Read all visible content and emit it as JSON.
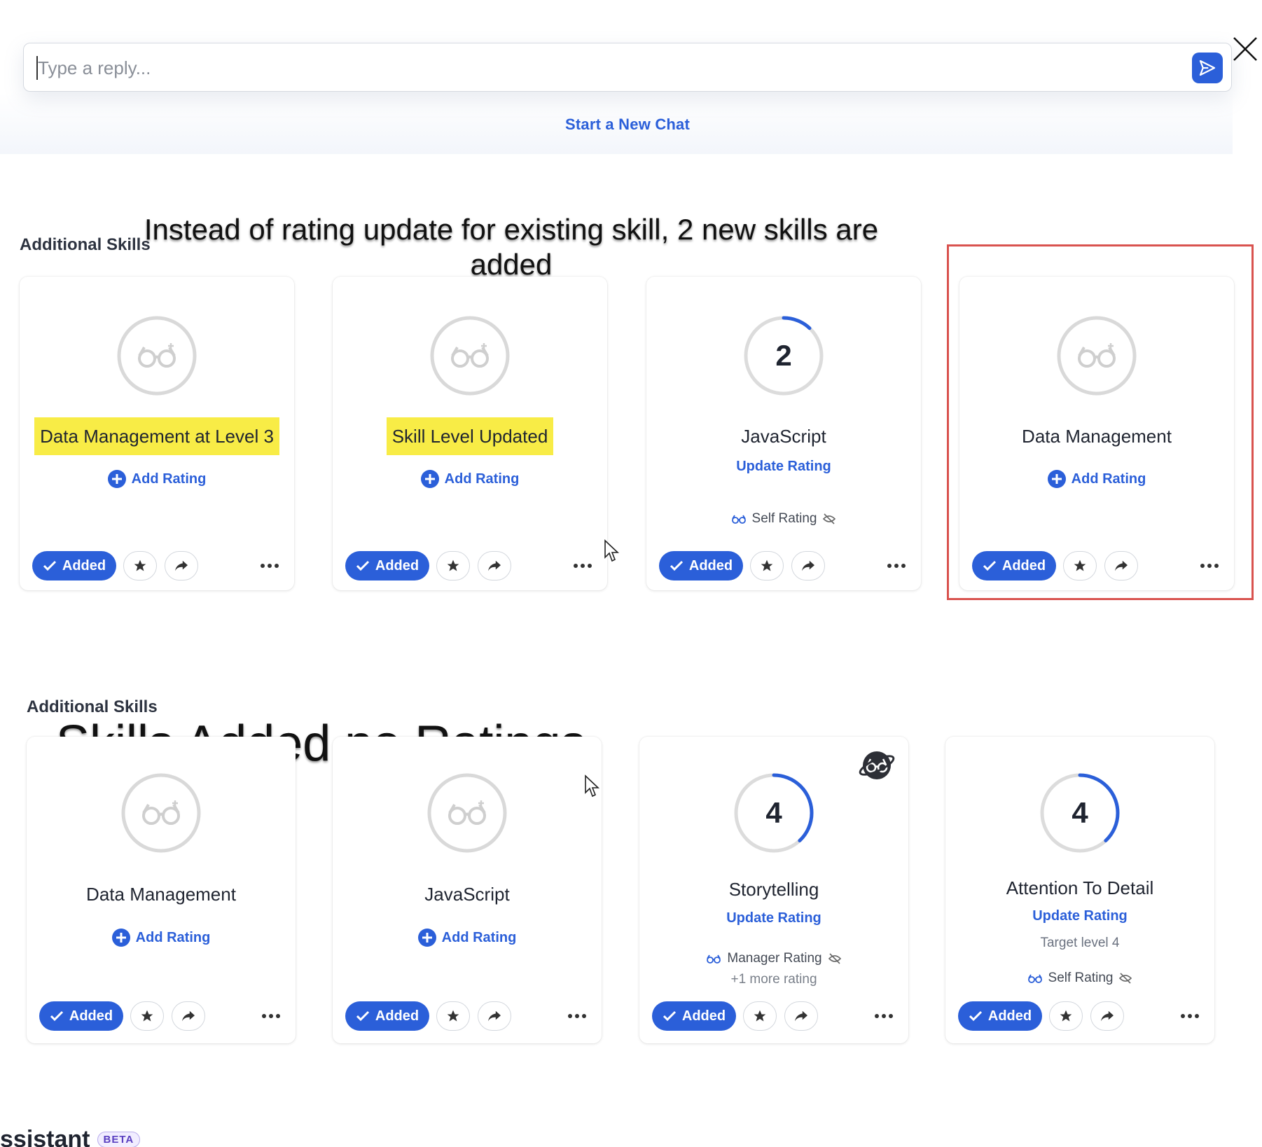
{
  "reply": {
    "placeholder": "Type a reply...",
    "start_new_chat": "Start a New Chat"
  },
  "sections": [
    {
      "title": "Additional Skills",
      "annotation": "Instead of rating update for existing skill, 2 new skills are added"
    },
    {
      "title": "Additional Skills",
      "annotation": "Skills Added no Ratings"
    }
  ],
  "row1": [
    {
      "name": "Data Management at Level 3",
      "highlighted": true,
      "rating": null,
      "link": "Add Rating",
      "added": "Added"
    },
    {
      "name": "Skill Level Updated",
      "highlighted": true,
      "rating": null,
      "link": "Add Rating",
      "added": "Added"
    },
    {
      "name": "JavaScript",
      "highlighted": false,
      "rating": "2",
      "rating_fraction": 0.12,
      "link": "Update Rating",
      "meta": "Self Rating",
      "added": "Added"
    },
    {
      "name": "Data Management",
      "highlighted": false,
      "rating": null,
      "link": "Add Rating",
      "added": "Added"
    }
  ],
  "row2": [
    {
      "name": "Data Management",
      "rating": null,
      "link": "Add Rating",
      "added": "Added"
    },
    {
      "name": "JavaScript",
      "rating": null,
      "link": "Add Rating",
      "added": "Added"
    },
    {
      "name": "Storytelling",
      "rating": "4",
      "rating_fraction": 0.38,
      "link": "Update Rating",
      "meta": "Manager Rating",
      "meta_sub": "+1 more rating",
      "added": "Added"
    },
    {
      "name": "Attention To Detail",
      "rating": "4",
      "rating_fraction": 0.38,
      "link": "Update Rating",
      "target": "Target level 4",
      "meta": "Self Rating",
      "added": "Added"
    }
  ],
  "footer": {
    "title": "ssistant",
    "badge": "BETA"
  },
  "colors": {
    "accent": "#2b5fd9",
    "highlight": "#f8ec46",
    "frame": "#d9534f"
  }
}
